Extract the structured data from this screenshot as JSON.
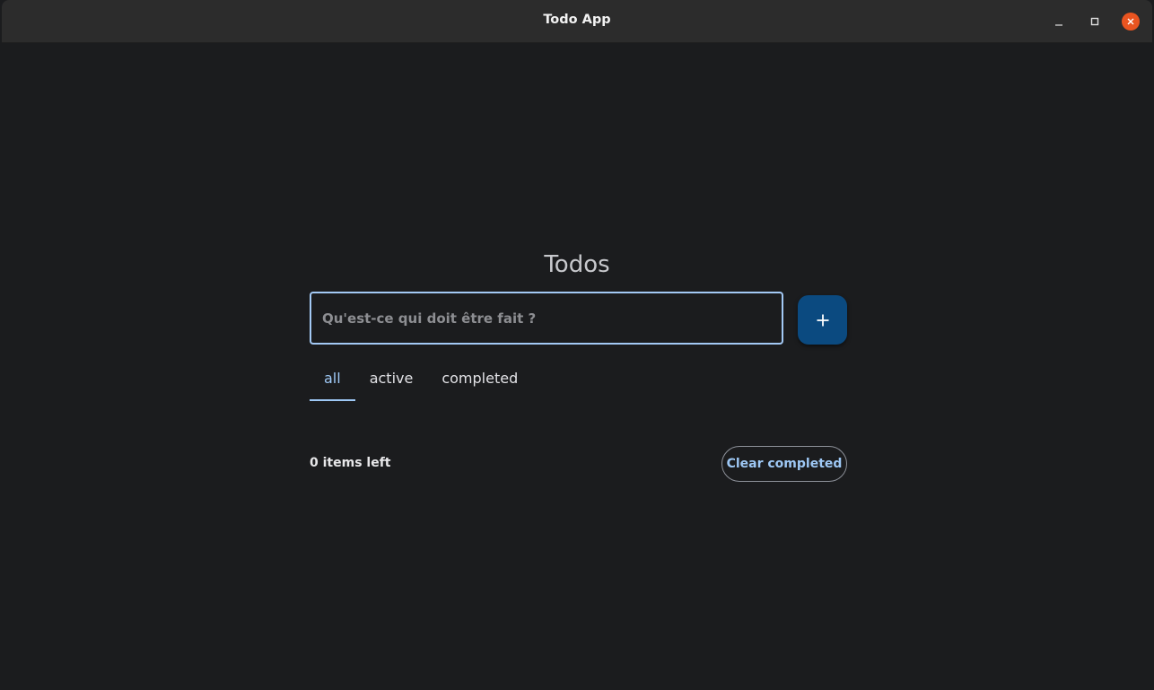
{
  "window": {
    "title": "Todo App",
    "minimize_icon": "minimize-icon",
    "maximize_icon": "maximize-icon",
    "close_icon": "close-icon",
    "close_color": "#e95420"
  },
  "app": {
    "heading": "Todos",
    "new_todo": {
      "placeholder": "Qu'est-ce qui doit être fait ?",
      "value": ""
    },
    "add_button_icon": "plus-icon",
    "tabs": [
      {
        "label": "all",
        "selected": true
      },
      {
        "label": "active",
        "selected": false
      },
      {
        "label": "completed",
        "selected": false
      }
    ],
    "footer": {
      "items_left": "0 items left",
      "clear_completed": "Clear completed"
    },
    "colors": {
      "background": "#1b1c1e",
      "accent": "#9ec8f5",
      "button": "#0b4a80"
    }
  }
}
